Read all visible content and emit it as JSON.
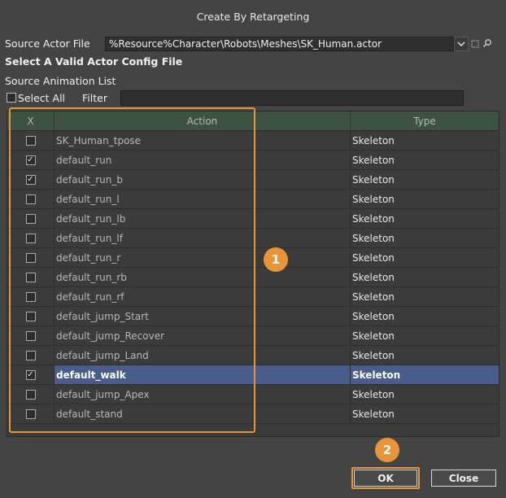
{
  "dialog": {
    "title": "Create By Retargeting"
  },
  "source": {
    "label": "Source Actor File",
    "value": "%Resource%Character\\Robots\\Meshes\\SK_Human.actor",
    "warning": "Select A Valid Actor Config File"
  },
  "list": {
    "label": "Source Animation List",
    "select_all_label": "Select All",
    "filter_label": "Filter",
    "filter_value": ""
  },
  "table": {
    "headers": {
      "x": "X",
      "action": "Action",
      "type": "Type"
    },
    "rows": [
      {
        "checked": false,
        "action": "SK_Human_tpose",
        "type": "Skeleton"
      },
      {
        "checked": true,
        "action": "default_run",
        "type": "Skeleton"
      },
      {
        "checked": true,
        "action": "default_run_b",
        "type": "Skeleton"
      },
      {
        "checked": false,
        "action": "default_run_l",
        "type": "Skeleton"
      },
      {
        "checked": false,
        "action": "default_run_lb",
        "type": "Skeleton"
      },
      {
        "checked": false,
        "action": "default_run_lf",
        "type": "Skeleton"
      },
      {
        "checked": false,
        "action": "default_run_r",
        "type": "Skeleton"
      },
      {
        "checked": false,
        "action": "default_run_rb",
        "type": "Skeleton"
      },
      {
        "checked": false,
        "action": "default_run_rf",
        "type": "Skeleton"
      },
      {
        "checked": false,
        "action": "default_jump_Start",
        "type": "Skeleton"
      },
      {
        "checked": false,
        "action": "default_jump_Recover",
        "type": "Skeleton"
      },
      {
        "checked": false,
        "action": "default_jump_Land",
        "type": "Skeleton"
      },
      {
        "checked": true,
        "action": "default_walk",
        "type": "Skeleton",
        "selected": true
      },
      {
        "checked": false,
        "action": "default_jump_Apex",
        "type": "Skeleton"
      },
      {
        "checked": false,
        "action": "default_stand",
        "type": "Skeleton"
      }
    ]
  },
  "callouts": {
    "one": "1",
    "two": "2"
  },
  "buttons": {
    "ok": "OK",
    "close": "Close"
  },
  "colors": {
    "highlight": "#e8953a",
    "selection": "#4a5d8a",
    "header": "#3e5244"
  }
}
